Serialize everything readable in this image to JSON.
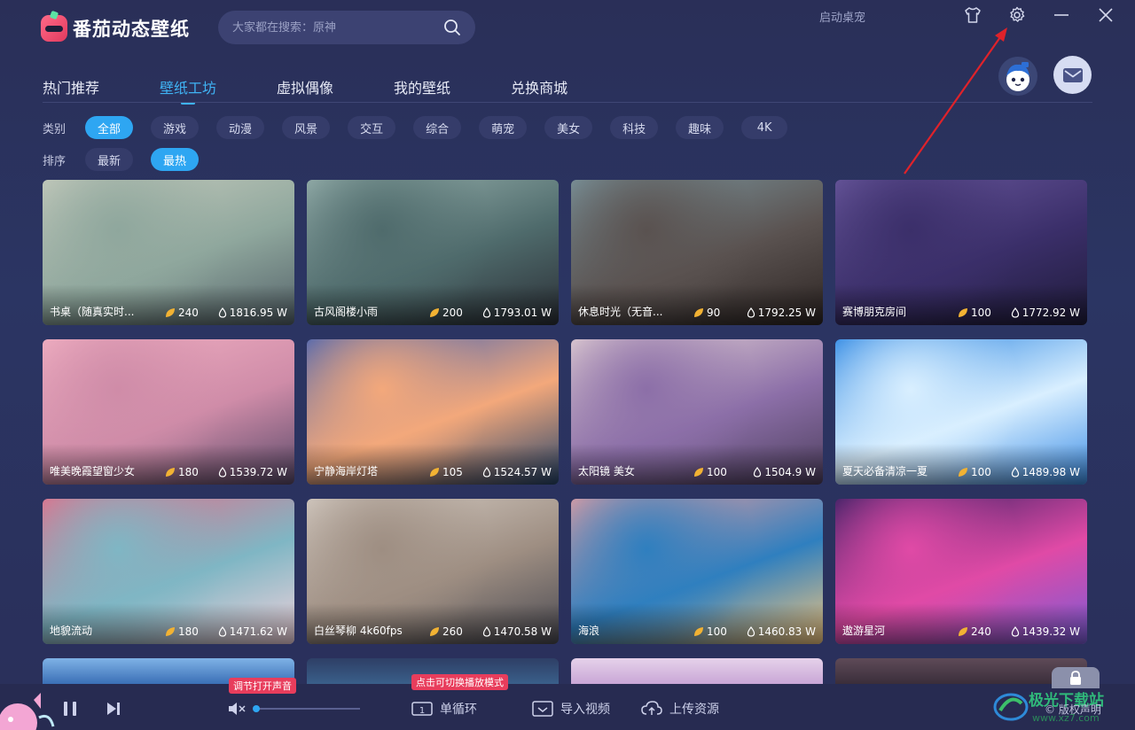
{
  "app": {
    "name": "番茄动态壁纸",
    "search_placeholder": "大家都在搜索：原神",
    "startup_label": "启动桌宠"
  },
  "nav": {
    "tabs": [
      "热门推荐",
      "壁纸工坊",
      "虚拟偶像",
      "我的壁纸",
      "兑换商城"
    ],
    "active_tab": "壁纸工坊"
  },
  "filters": {
    "category_label": "类别",
    "categories": [
      "全部",
      "游戏",
      "动漫",
      "风景",
      "交互",
      "综合",
      "萌宠",
      "美女",
      "科技",
      "趣味",
      "4K"
    ],
    "active_category": "全部",
    "sort_label": "排序",
    "sorts": [
      "最新",
      "最热"
    ],
    "active_sort": "最热"
  },
  "wallpapers": [
    {
      "title": "书桌（随真实时...",
      "likes": "240",
      "views": "1816.95 W",
      "colors": [
        "#c9cdbf",
        "#8fa79d",
        "#55636a"
      ]
    },
    {
      "title": "古风阁楼小雨",
      "likes": "200",
      "views": "1793.01 W",
      "colors": [
        "#9db6b2",
        "#4f6b6c",
        "#2b2f36"
      ]
    },
    {
      "title": "休息时光（无音...",
      "likes": "90",
      "views": "1792.25 W",
      "colors": [
        "#7e9aa3",
        "#5a5250",
        "#2d2523"
      ]
    },
    {
      "title": "赛博朋克房间",
      "likes": "100",
      "views": "1772.92 W",
      "colors": [
        "#6c5aa0",
        "#3b2f6a",
        "#1f1b3a"
      ]
    },
    {
      "title": "唯美晚霞望窗少女",
      "likes": "180",
      "views": "1539.72 W",
      "colors": [
        "#f3b2c4",
        "#cf8ca8",
        "#5b4a6a"
      ]
    },
    {
      "title": "宁静海岸灯塔",
      "likes": "105",
      "views": "1524.57 W",
      "colors": [
        "#3b5fb6",
        "#f3a87b",
        "#27456b"
      ]
    },
    {
      "title": "太阳镜 美女",
      "likes": "100",
      "views": "1504.9 W",
      "colors": [
        "#e7d6d6",
        "#8c6fa8",
        "#4e3f5e"
      ]
    },
    {
      "title": "夏天必备清凉一夏",
      "likes": "100",
      "views": "1489.98 W",
      "colors": [
        "#1d7de0",
        "#d9efff",
        "#3d8ee6"
      ]
    },
    {
      "title": "地貌流动",
      "likes": "180",
      "views": "1471.62 W",
      "colors": [
        "#ea6a86",
        "#7fb6c4",
        "#f3d3dc"
      ]
    },
    {
      "title": "白丝琴柳 4k60fps",
      "likes": "260",
      "views": "1470.58 W",
      "colors": [
        "#d8d0c8",
        "#9e8e82",
        "#4a4a52"
      ]
    },
    {
      "title": "海浪",
      "likes": "100",
      "views": "1460.83 W",
      "colors": [
        "#f0a0a0",
        "#2f7fbf",
        "#f5c77e"
      ]
    },
    {
      "title": "遨游星河",
      "likes": "240",
      "views": "1439.32 W",
      "colors": [
        "#2a1d5e",
        "#e04aa6",
        "#7a5cd6"
      ]
    }
  ],
  "partial_row_colors": [
    [
      "#3a6fb6",
      "#7fb2e6"
    ],
    [
      "#3a5f8a",
      "#2e3f66"
    ],
    [
      "#c9a6d6",
      "#e6d2ea"
    ],
    [
      "#3a2e3a",
      "#5e4a58"
    ]
  ],
  "player": {
    "sound_tip": "调节打开声音",
    "mode_tip": "点击可切换播放模式",
    "loop_label": "单循环",
    "import_label": "导入视频",
    "upload_label": "上传资源",
    "copyright_label": "版权声明",
    "volume": 0.02
  },
  "watermark": {
    "text": "极光下载站",
    "sub": "www.xz7.com"
  },
  "accent": "#2ea6f2",
  "annotation_color": "#e0222a"
}
